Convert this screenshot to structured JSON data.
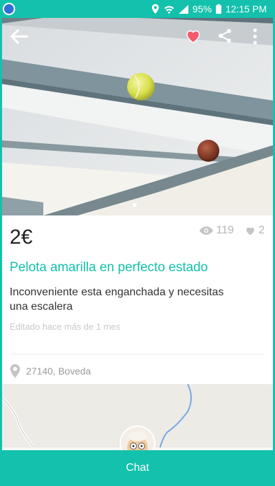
{
  "status_bar": {
    "battery": "95%",
    "time": "12:15 PM"
  },
  "listing": {
    "price": "2€",
    "views": "119",
    "favorites": "2",
    "title": "Pelota amarilla en perfecto estado",
    "description": "Inconveniente esta enganchada y necesitas una escalera",
    "edited": "Editado hace más de 1 mes",
    "location": "27140, Boveda",
    "favorited": true
  },
  "actions": {
    "chat_label": "Chat"
  },
  "icons": {
    "back": "arrow-left-icon",
    "heart": "heart-icon",
    "share": "share-icon",
    "more": "more-vert-icon",
    "views": "eye-icon",
    "favorites": "heart-outline-icon",
    "location": "map-pin-icon"
  },
  "colors": {
    "accent": "#13c1ac",
    "favorite": "#f55a6a"
  }
}
